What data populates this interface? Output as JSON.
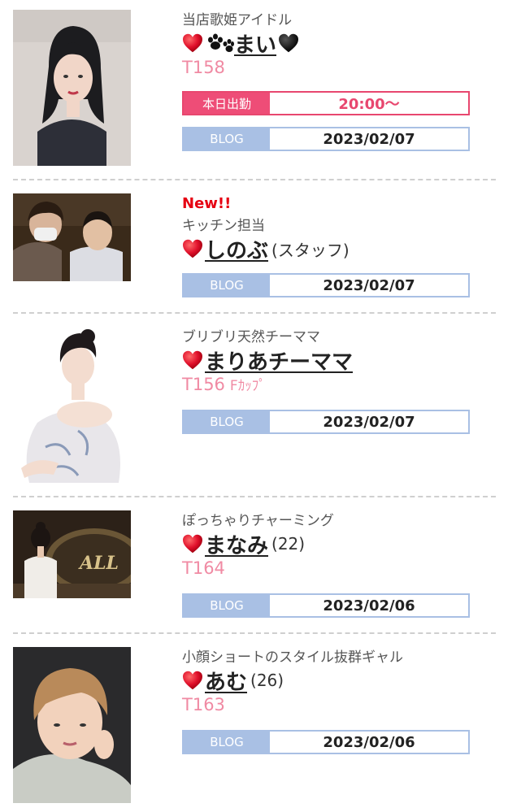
{
  "colors": {
    "accent_pink": "#ee4d77",
    "height_pink": "#f08aa3",
    "blog_blue": "#a9c0e4",
    "new_red": "#e60012",
    "heart_red": "#e0102b"
  },
  "cast": [
    {
      "tagline": "当店歌姫アイドル",
      "name": "まい",
      "decor": [
        "heart-icon",
        "paw-icon",
        "black-heart-icon"
      ],
      "height": "T158",
      "work": {
        "label": "本日出勤",
        "time": "20:00〜"
      },
      "blog": {
        "label": "BLOG",
        "date": "2023/02/07"
      }
    },
    {
      "new_badge": "New!!",
      "tagline": "キッチン担当",
      "name": "しのぶ",
      "suffix": "(スタッフ)",
      "blog": {
        "label": "BLOG",
        "date": "2023/02/07"
      }
    },
    {
      "tagline": "ブリブリ天然チーママ",
      "name": "まりあチーママ",
      "height": "T156",
      "cup": "Fｶｯﾌﾟ",
      "blog": {
        "label": "BLOG",
        "date": "2023/02/07"
      }
    },
    {
      "tagline": "ぽっちゃりチャーミング",
      "name": "まなみ",
      "suffix": "(22)",
      "height": "T164",
      "blog": {
        "label": "BLOG",
        "date": "2023/02/06"
      }
    },
    {
      "tagline": "小顔ショートのスタイル抜群ギャル",
      "name": "あむ",
      "suffix": "(26)",
      "height": "T163",
      "blog": {
        "label": "BLOG",
        "date": "2023/02/06"
      }
    }
  ]
}
